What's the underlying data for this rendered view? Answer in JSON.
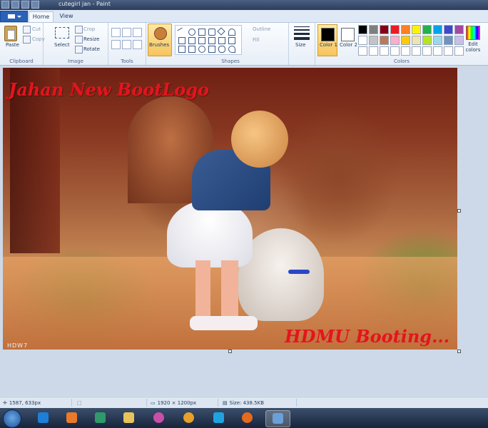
{
  "window": {
    "title": "cutegirl jan - Paint"
  },
  "tabs": [
    {
      "label": "Home"
    },
    {
      "label": "View"
    }
  ],
  "ribbon": {
    "clipboard": {
      "label": "Clipboard",
      "paste": "Paste",
      "cut": "Cut",
      "copy": "Copy"
    },
    "image": {
      "label": "Image",
      "select": "Select",
      "crop": "Crop",
      "resize": "Resize",
      "rotate": "Rotate"
    },
    "tools": {
      "label": "Tools"
    },
    "brushes": {
      "label": "Brushes"
    },
    "shapes": {
      "label": "Shapes",
      "outline": "Outline",
      "fill": "Fill"
    },
    "size": {
      "label": "Size"
    },
    "colors": {
      "label": "Colors",
      "color1": "Color 1",
      "color2": "Color 2",
      "edit": "Edit colors",
      "color1_value": "#000000",
      "color2_value": "#ffffff",
      "palette": [
        "#000000",
        "#7f7f7f",
        "#880015",
        "#ed1c24",
        "#ff7f27",
        "#fff200",
        "#22b14c",
        "#00a2e8",
        "#3f48cc",
        "#a349a4",
        "#ffffff",
        "#c3c3c3",
        "#b97a57",
        "#ffaec9",
        "#ffc90e",
        "#efe4b0",
        "#b5e61d",
        "#99d9ea",
        "#7092be",
        "#c8bfe7",
        "#ffffff",
        "#ffffff",
        "#ffffff",
        "#ffffff",
        "#ffffff",
        "#ffffff",
        "#ffffff",
        "#ffffff",
        "#ffffff",
        "#ffffff"
      ]
    }
  },
  "canvas": {
    "title_overlay": "Jahan New BootLogo",
    "footer_overlay": "HDMU Booting...",
    "watermark": "HDW7"
  },
  "status": {
    "cursor": "1587, 633px",
    "dimensions": "1920 × 1200px",
    "size": "Size: 438.5KB"
  },
  "taskbar": {
    "items": [
      {
        "icon": "internet-explorer-icon",
        "color": "#1e7fd8"
      },
      {
        "icon": "media-player-icon",
        "color": "#e87a2a"
      },
      {
        "icon": "chart-app-icon",
        "color": "#2e9a6a"
      },
      {
        "icon": "folder-icon",
        "color": "#e8c25a"
      },
      {
        "icon": "picasa-icon",
        "color": "#c84fa8"
      },
      {
        "icon": "colorful-app-icon",
        "color": "#e8a02a"
      },
      {
        "icon": "skype-icon",
        "color": "#1fa3e0"
      },
      {
        "icon": "firefox-icon",
        "color": "#e66a1c"
      },
      {
        "icon": "paint-icon",
        "color": "#6aa0d8"
      }
    ]
  }
}
